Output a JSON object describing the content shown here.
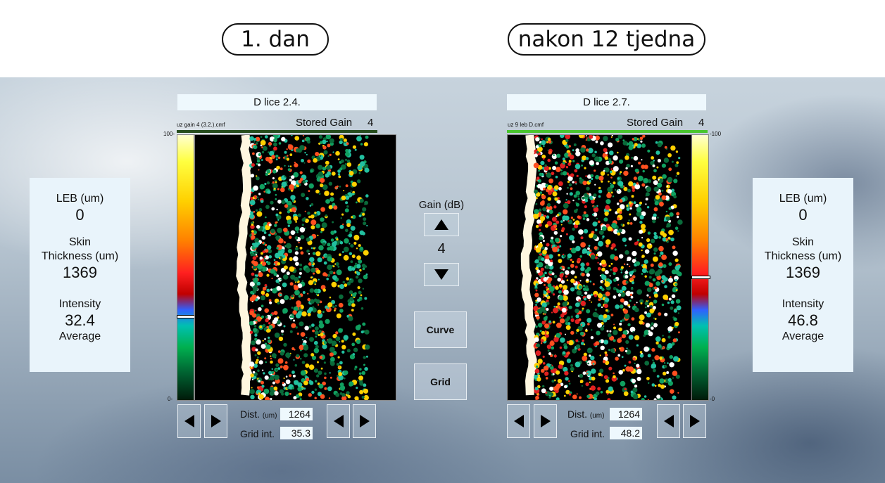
{
  "captions": {
    "left": "1. dan",
    "right": "nakon 12 tjedna"
  },
  "left": {
    "title": "D lice 2.4.",
    "file": "uz gain 4 (3.2.).cmf",
    "stored_gain_label": "Stored Gain",
    "stored_gain_value": "4",
    "scale_top": "100-",
    "scale_bottom": "0-",
    "colorbar_marker_fraction": 0.68,
    "stats": {
      "leb_label": "LEB (um)",
      "leb_value": "0",
      "skin_label_1": "Skin",
      "skin_label_2": "Thickness (um)",
      "skin_value": "1369",
      "intensity_label": "Intensity",
      "intensity_value": "32.4",
      "average_label": "Average"
    },
    "dist_label": "Dist.",
    "dist_unit": "(um)",
    "dist_value": "1264",
    "grid_label": "Grid int.",
    "grid_value": "35.3"
  },
  "right": {
    "title": "D lice 2.7.",
    "file": "uz 9 leb D.cmf",
    "stored_gain_label": "Stored Gain",
    "stored_gain_value": "4",
    "scale_top": "-100",
    "scale_bottom": "-0",
    "colorbar_marker_fraction": 0.53,
    "stats": {
      "leb_label": "LEB (um)",
      "leb_value": "0",
      "skin_label_1": "Skin",
      "skin_label_2": "Thickness (um)",
      "skin_value": "1369",
      "intensity_label": "Intensity",
      "intensity_value": "46.8",
      "average_label": "Average"
    },
    "dist_label": "Dist.",
    "dist_unit": "(um)",
    "dist_value": "1264",
    "grid_label": "Grid int.",
    "grid_value": "48.2"
  },
  "controls": {
    "gain_label": "Gain (dB)",
    "gain_value": "4",
    "curve_label": "Curve",
    "grid_label": "Grid"
  },
  "icons": {
    "gain_up": "up-triangle-icon",
    "gain_down": "down-triangle-icon",
    "nav_left": "left-triangle-icon",
    "nav_right": "right-triangle-icon"
  }
}
